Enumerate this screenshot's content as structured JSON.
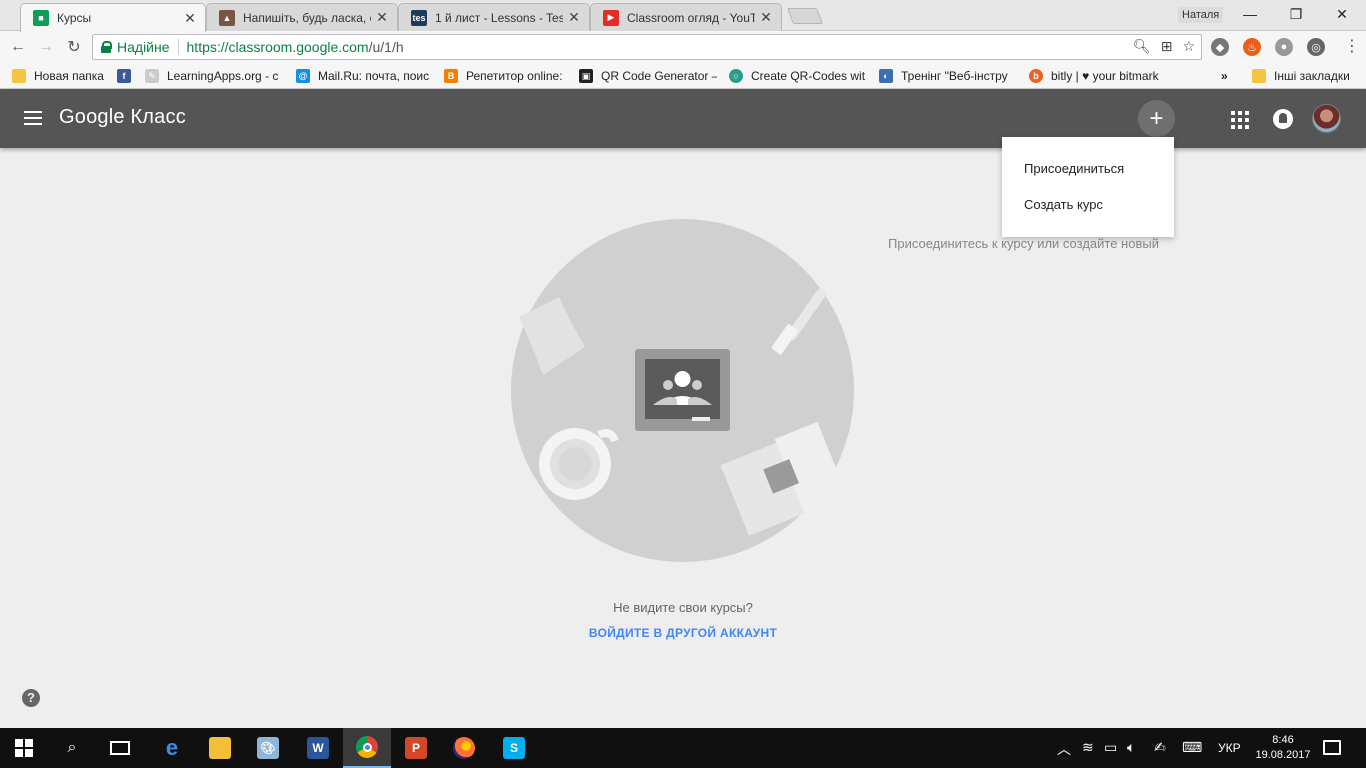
{
  "browser": {
    "tabs": [
      {
        "title": "Курсы",
        "favicon_color": "#0f9d58",
        "active": true
      },
      {
        "title": "Напишіть, будь ласка, сг",
        "favicon_color": "#795548",
        "active": false
      },
      {
        "title": "1 й лист - Lessons - Tes T",
        "favicon_color": "#1b3a5c",
        "favicon_text": "tes",
        "active": false
      },
      {
        "title": "Classroom огляд - YouTu",
        "favicon_color": "#e52d27",
        "active": false
      }
    ],
    "profile_name": "Наталя",
    "secure_label": "Надійне",
    "url_host": "https://classroom.google.com",
    "url_path": "/u/1/h",
    "bookmarks": [
      {
        "label": "Новая папка",
        "icon": "folder-icon"
      },
      {
        "label": "LearningApps.org - с",
        "icon": "learningapps-icon"
      },
      {
        "label": "Mail.Ru: почта, поис",
        "icon": "mailru-icon"
      },
      {
        "label": "Репетитор online:",
        "icon": "blogger-icon"
      },
      {
        "label": "QR Code Generator –",
        "icon": "qr-icon"
      },
      {
        "label": "Create QR-Codes wit",
        "icon": "qr-create-icon"
      },
      {
        "label": "Тренінг \"Веб-інстру",
        "icon": "training-icon"
      },
      {
        "label": "bitly | ♥ your bitmark",
        "icon": "bitly-icon"
      }
    ],
    "other_bookmarks": "Інші закладки"
  },
  "app": {
    "title": "Google Класс",
    "menu": [
      "Присоединиться",
      "Создать курс"
    ],
    "hint": "Присоединитесь к курсу или создайте новый",
    "no_courses": "Не видите свои курсы?",
    "switch_account": "ВОЙДИТЕ В ДРУГОЙ АККАУНТ"
  },
  "taskbar": {
    "language": "УКР",
    "time": "8:46",
    "date": "19.08.2017"
  }
}
